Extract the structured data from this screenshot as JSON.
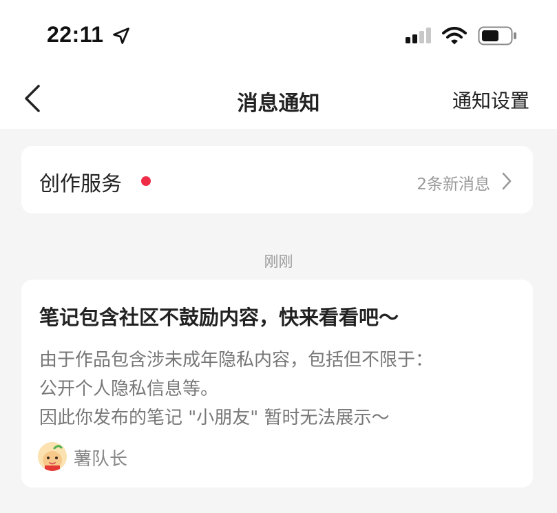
{
  "status_bar": {
    "time": "22:11",
    "icons": [
      "location-arrow-icon",
      "signal-icon",
      "wifi-icon",
      "battery-icon"
    ]
  },
  "nav": {
    "title": "消息通知",
    "settings_label": "通知设置",
    "back_icon": "chevron-left-icon"
  },
  "service_card": {
    "title": "创作服务",
    "unread_dot_color": "#f02d46",
    "count_label": "2条新消息"
  },
  "timestamp": "刚刚",
  "message": {
    "title": "笔记包含社区不鼓励内容，快来看看吧～",
    "body_lines": [
      "由于作品包含涉未成年隐私内容，包括但不限于：",
      "公开个人隐私信息等。",
      "因此你发布的笔记 \"小朋友\" 暂时无法展示～"
    ],
    "sender": "薯队长",
    "sender_avatar": "potato-mascot-avatar"
  },
  "colors": {
    "background": "#f5f5f5",
    "card": "#ffffff",
    "accent_red": "#f02d46",
    "muted_text": "#999999"
  }
}
